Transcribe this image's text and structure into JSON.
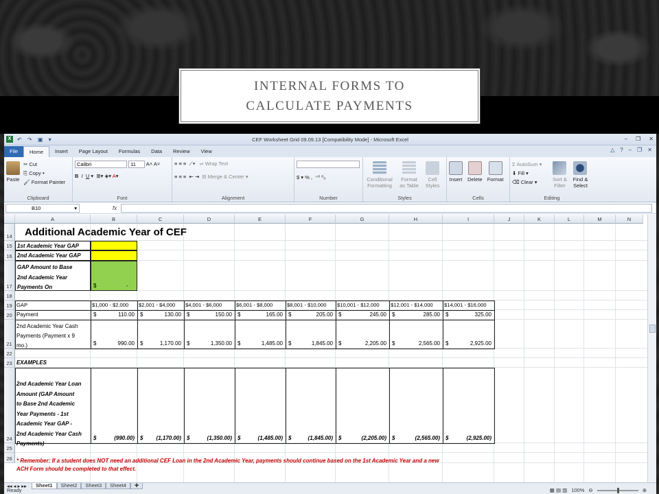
{
  "slide": {
    "title": "INTERNAL  FORMS TO CALCULATE PAYMENTS"
  },
  "window": {
    "title": "CEF Worksheet Grid 09.09.13  [Compatibility Mode]  -  Microsoft Excel",
    "app_icon": "X"
  },
  "menu": {
    "file": "File",
    "tabs": [
      "Home",
      "Insert",
      "Page Layout",
      "Formulas",
      "Data",
      "Review",
      "View"
    ]
  },
  "ribbon": {
    "clipboard": {
      "paste": "Paste",
      "cut": "Cut",
      "copy": "Copy",
      "format_painter": "Format Painter",
      "label": "Clipboard"
    },
    "font": {
      "name": "Calibri",
      "size": "11",
      "bold": "B",
      "italic": "I",
      "underline": "U",
      "label": "Font"
    },
    "alignment": {
      "wrap": "Wrap Text",
      "merge": "Merge & Center",
      "label": "Alignment"
    },
    "number": {
      "currency": "$",
      "percent": "%",
      "comma": ",",
      "label": "Number"
    },
    "styles": {
      "cond": "Conditional Formatting",
      "table": "Format as Table",
      "cell": "Cell Styles",
      "label": "Styles"
    },
    "cells": {
      "insert": "Insert",
      "delete": "Delete",
      "format": "Format",
      "label": "Cells"
    },
    "editing": {
      "autosum": "AutoSum",
      "fill": "Fill",
      "clear": "Clear",
      "sort": "Sort & Filter",
      "find": "Find & Select",
      "label": "Editing"
    }
  },
  "formula_bar": {
    "name_box": "B10",
    "fx": "fx",
    "formula": ""
  },
  "columns": [
    "A",
    "B",
    "C",
    "D",
    "E",
    "F",
    "G",
    "H",
    "I",
    "J",
    "K",
    "L",
    "M",
    "N"
  ],
  "rows": [
    "14",
    "15",
    "16",
    "17",
    "18",
    "19",
    "20",
    "21",
    "22",
    "23",
    "24",
    "25",
    "26"
  ],
  "cells": {
    "heading": "Additional Academic Year of CEF",
    "r15": "1st Academic Year GAP",
    "r16": "2nd Academic Year GAP",
    "r17": [
      "GAP Amount to Base",
      "2nd Academic Year",
      "Payments On"
    ],
    "r17b_sym": "$",
    "r17b_val": "-",
    "r19": [
      "GAP",
      "$1,000 - $2,000",
      "$2,001 - $4,000",
      "$4,001 - $6,000",
      "$6,001 - $8,000",
      "$8,001 - $10,000",
      "$10,001 - $12,000",
      "$12,001 - $14,000",
      "$14,001 - $16,000"
    ],
    "r20_label": "Payment",
    "r20": [
      "110.00",
      "130.00",
      "150.00",
      "165.00",
      "205.00",
      "245.00",
      "285.00",
      "325.00"
    ],
    "r21_label": [
      "2nd Academic Year Cash",
      "Payments (Payment x 9",
      "mo.)"
    ],
    "r21": [
      "990.00",
      "1,170.00",
      "1,350.00",
      "1,485.00",
      "1,845.00",
      "2,205.00",
      "2,565.00",
      "2,925.00"
    ],
    "r23": "EXAMPLES",
    "r24_label": [
      "2nd Academic Year Loan",
      "Amount (GAP Amount",
      "to Base 2nd Academic",
      "Year Payments - 1st",
      "Academic Year GAP -",
      "2nd Academic Year Cash",
      "Payments)"
    ],
    "r24": [
      "(990.00)",
      "(1,170.00)",
      "(1,350.00)",
      "(1,485.00)",
      "(1,845.00)",
      "(2,205.00)",
      "(2,565.00)",
      "(2,925.00)"
    ],
    "r26": [
      "* Remember:  If a student does NOT need an additional CEF Loan in the 2nd Academic Year, payments should continue based on the 1st Academic Year and a new",
      "ACH Form should be completed to that effect."
    ]
  },
  "sheet_tabs": [
    "Sheet1",
    "Sheet2",
    "Sheet3",
    "Sheet4"
  ],
  "status": {
    "ready": "Ready",
    "zoom": "100%"
  }
}
